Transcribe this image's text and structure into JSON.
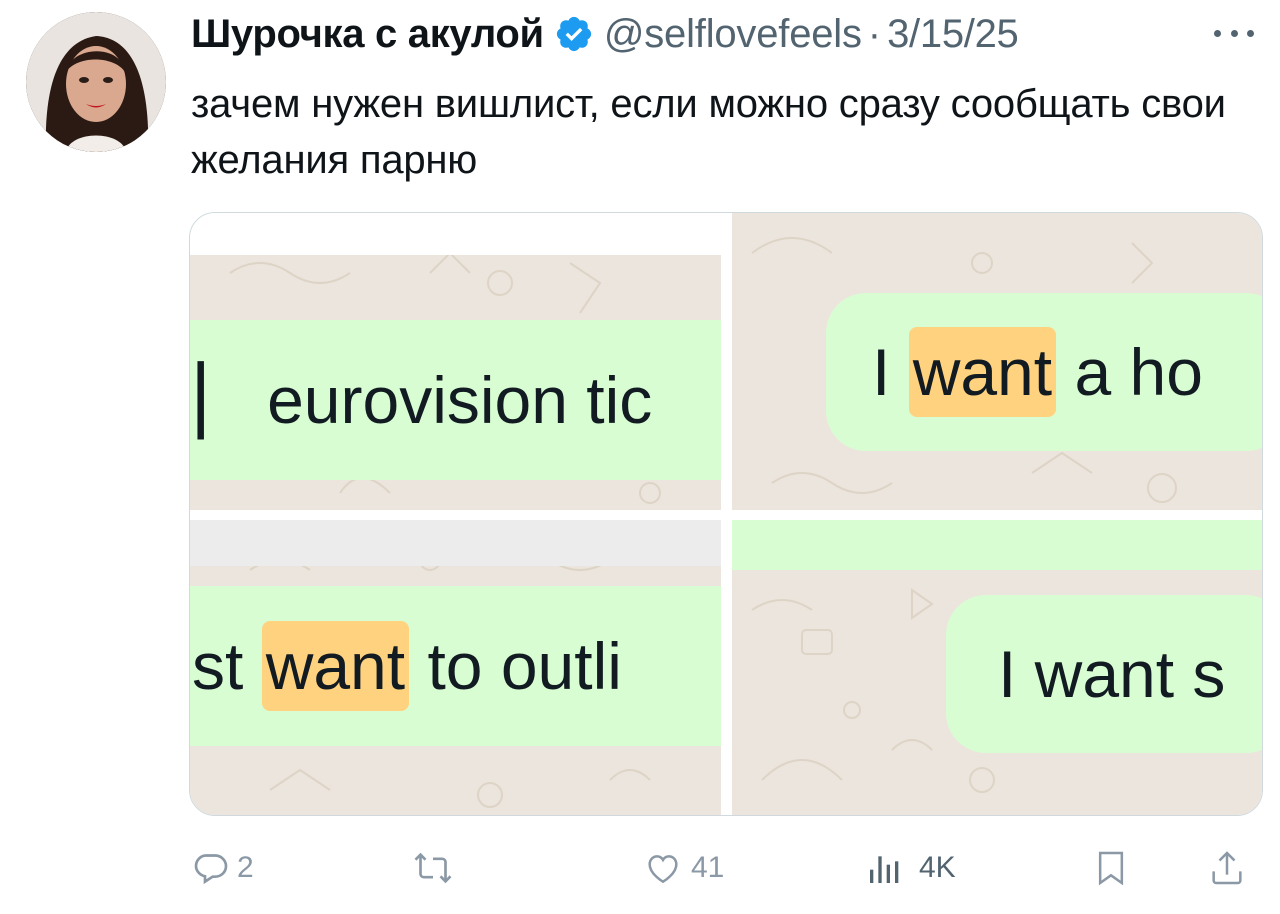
{
  "author": {
    "name": "Шурочка с акулой",
    "verified_icon": "verified-badge-icon",
    "handle": "@selflovefeels",
    "separator": "·",
    "date": "3/15/25",
    "more_icon": "more-horizontal-icon"
  },
  "tweet": {
    "text": "зачем нужен вишлист, если можно сразу сообщать свои желания парню"
  },
  "media": {
    "panels": [
      {
        "before": "▏ eurovision tic",
        "highlight": "",
        "after": ""
      },
      {
        "before": "I ",
        "highlight": "want",
        "after": " a ho"
      },
      {
        "before": "st ",
        "highlight": "want",
        "after": " to outli"
      },
      {
        "before": "I want s",
        "highlight": "",
        "after": ""
      }
    ]
  },
  "actions": {
    "reply": {
      "icon": "reply-icon",
      "count": "2"
    },
    "retweet": {
      "icon": "retweet-icon",
      "count": ""
    },
    "like": {
      "icon": "heart-icon",
      "count": "41"
    },
    "views": {
      "icon": "views-icon",
      "count": "4K"
    },
    "bookmark": {
      "icon": "bookmark-icon"
    },
    "share": {
      "icon": "share-icon"
    }
  },
  "colors": {
    "accent_blue": "#1d9bf0",
    "muted_text": "#536471",
    "bubble_green": "#d9fdd3",
    "chat_background": "#ece5dd",
    "highlight": "#ffd27f"
  }
}
